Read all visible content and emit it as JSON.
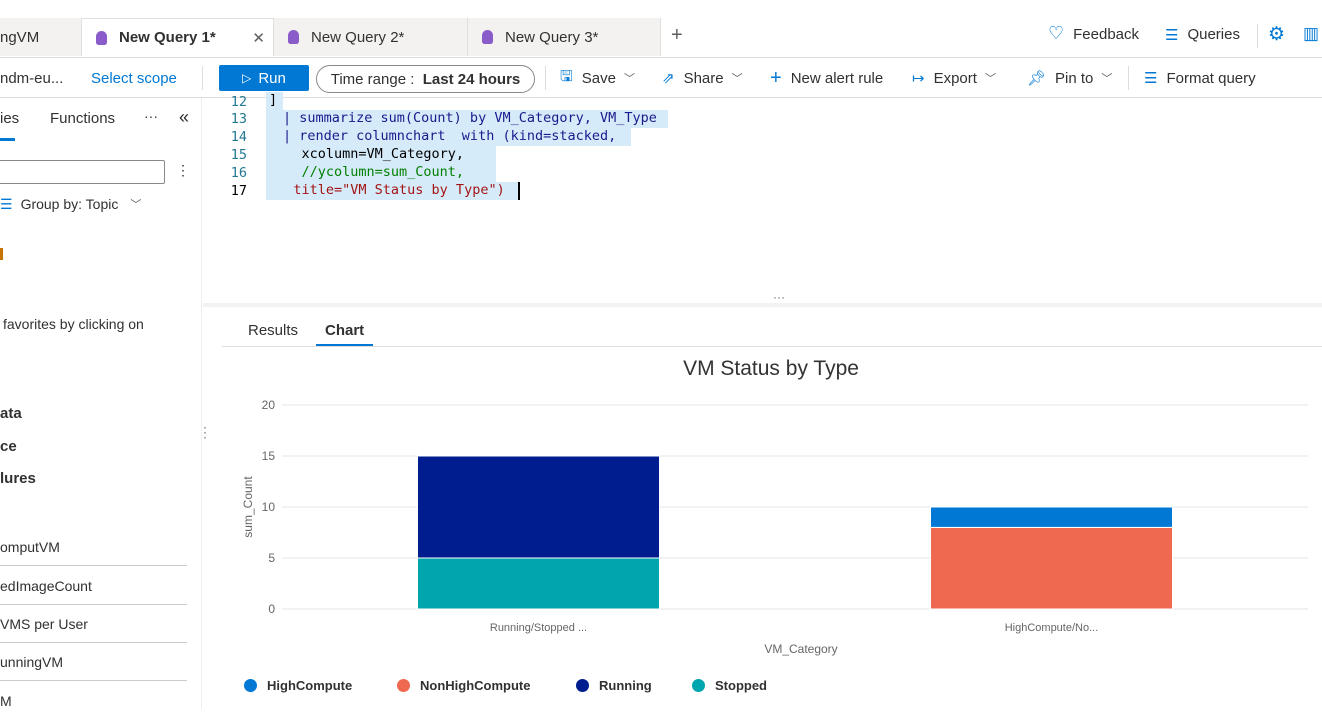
{
  "tabs": [
    {
      "label": "ngVM"
    },
    {
      "label": "New Query 1*"
    },
    {
      "label": "New Query 2*"
    },
    {
      "label": "New Query 3*"
    }
  ],
  "header": {
    "feedback": "Feedback",
    "queries": "Queries"
  },
  "toolbar": {
    "scope": "ndm-eu...",
    "select_scope": "Select scope",
    "run": "Run",
    "time_label": "Time range :",
    "time_value": "Last 24 hours",
    "save": "Save",
    "share": "Share",
    "new_alert": "New alert rule",
    "export": "Export",
    "pin": "Pin to",
    "format": "Format query"
  },
  "sidebar": {
    "tab_queries": "ies",
    "tab_functions": "Functions",
    "group_by": "Group by: Topic",
    "favorites_text": "favorites by clicking on",
    "headings": [
      "ata",
      "ce",
      "lures"
    ],
    "items": [
      "omputVM",
      "edImageCount",
      "VMS per User",
      "unningVM",
      "M"
    ]
  },
  "editor": {
    "lines": [
      {
        "num": "12",
        "text": "]"
      },
      {
        "num": "13",
        "text": "| summarize sum(Count) by VM_Category, VM_Type"
      },
      {
        "num": "14",
        "text": "| render columnchart  with (kind=stacked,"
      },
      {
        "num": "15",
        "text": "    xcolumn=VM_Category,"
      },
      {
        "num": "16",
        "text": "    //ycolumn=sum_Count,"
      },
      {
        "num": "17",
        "text": "   title=\"VM Status by Type\")"
      }
    ]
  },
  "results": {
    "tab_results": "Results",
    "tab_chart": "Chart"
  },
  "chart_data": {
    "type": "bar",
    "stacked": true,
    "title": "VM Status by Type",
    "xlabel": "VM_Category",
    "ylabel": "sum_Count",
    "categories": [
      "Running/Stopped ...",
      "HighCompute/No..."
    ],
    "ylim": [
      0,
      20
    ],
    "yticks": [
      "0",
      "5",
      "10",
      "15",
      "20"
    ],
    "grid": true,
    "legend": "bottom-left",
    "series": [
      {
        "name": "HighCompute",
        "color": "#0078d4",
        "values": [
          0,
          2
        ]
      },
      {
        "name": "NonHighCompute",
        "color": "#ef6950",
        "values": [
          0,
          8
        ]
      },
      {
        "name": "Running",
        "color": "#001d8f",
        "values": [
          10,
          0
        ]
      },
      {
        "name": "Stopped",
        "color": "#00a5ad",
        "values": [
          5,
          0
        ]
      }
    ]
  }
}
